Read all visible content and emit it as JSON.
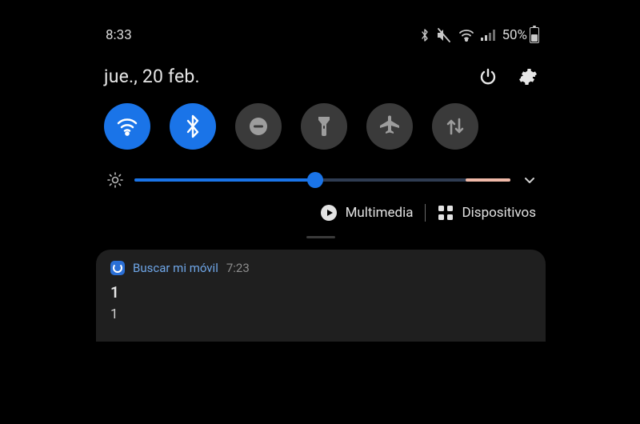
{
  "status": {
    "time": "8:33",
    "battery_text": "50%",
    "battery_level": 0.5,
    "icons": {
      "bluetooth": "bluetooth-icon",
      "mute": "mute-icon",
      "wifi": "wifi-icon",
      "signal": "signal-icon"
    }
  },
  "header": {
    "date": "jue., 20 feb.",
    "power_icon": "power-icon",
    "settings_icon": "gear-icon"
  },
  "quick_toggles": [
    {
      "name": "wifi",
      "active": true
    },
    {
      "name": "bluetooth",
      "active": true
    },
    {
      "name": "dnd",
      "active": false
    },
    {
      "name": "flashlight",
      "active": false
    },
    {
      "name": "airplane",
      "active": false
    },
    {
      "name": "mobiledata",
      "active": false
    }
  ],
  "brightness": {
    "value": 0.48,
    "expand_icon": "chevron-down-icon"
  },
  "panel_shortcuts": {
    "multimedia_label": "Multimedia",
    "devices_label": "Dispositivos"
  },
  "notification": {
    "app_name": "Buscar mi móvil",
    "time": "7:23",
    "title": "1",
    "body": "1"
  },
  "colors": {
    "accent": "#1a74e8",
    "toggle_off": "#3a3a3a",
    "card": "#1f1f1f"
  }
}
